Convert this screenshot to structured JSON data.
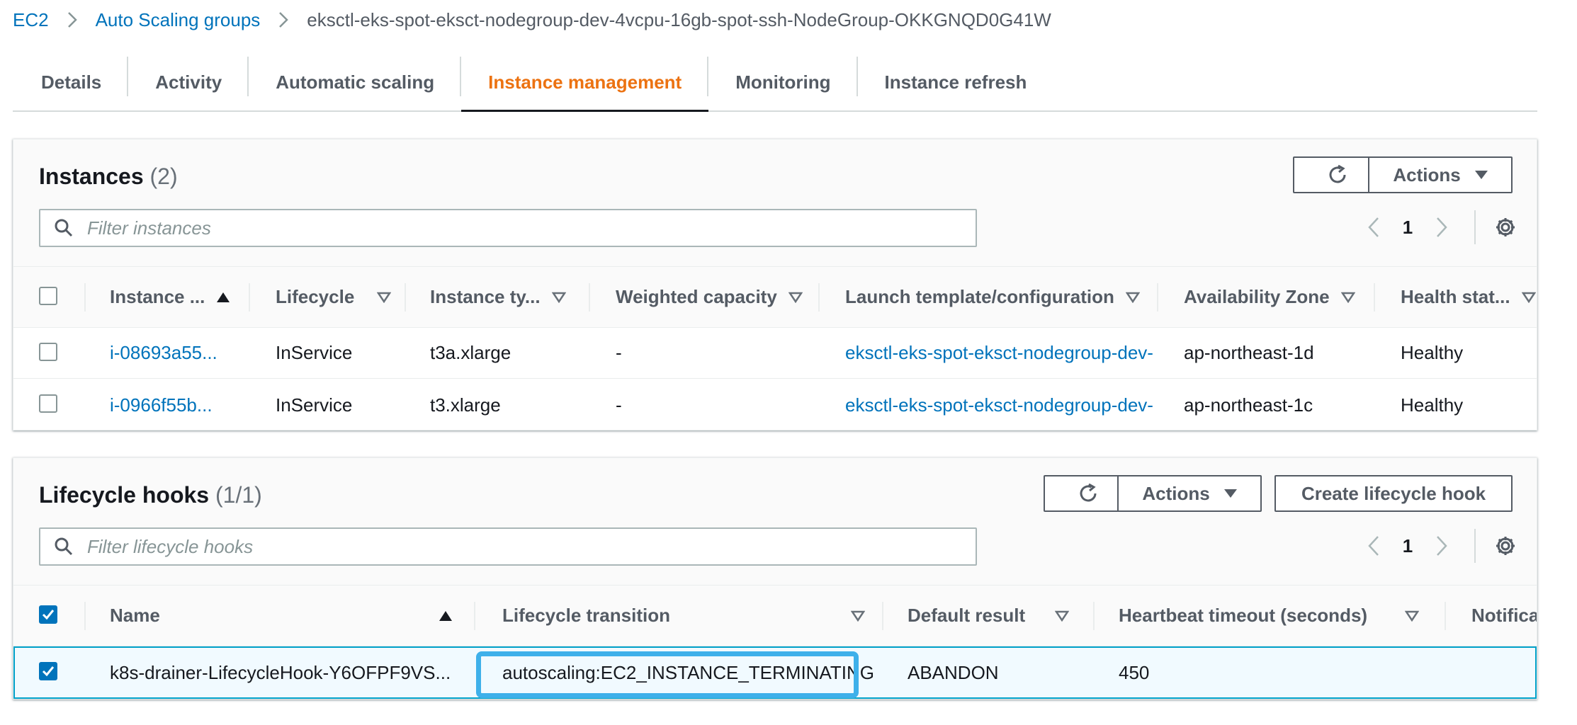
{
  "breadcrumb": {
    "items": [
      "EC2",
      "Auto Scaling groups"
    ],
    "current": "eksctl-eks-spot-eksct-nodegroup-dev-4vcpu-16gb-spot-ssh-NodeGroup-OKKGNQD0G41W"
  },
  "tabs": [
    {
      "label": "Details"
    },
    {
      "label": "Activity"
    },
    {
      "label": "Automatic scaling"
    },
    {
      "label": "Instance management",
      "active": true
    },
    {
      "label": "Monitoring"
    },
    {
      "label": "Instance refresh"
    }
  ],
  "instances": {
    "title": "Instances",
    "count": "(2)",
    "actions_label": "Actions",
    "filter_placeholder": "Filter instances",
    "page": "1",
    "columns": [
      "Instance ...",
      "Lifecycle",
      "Instance ty...",
      "Weighted capacity",
      "Launch template/configuration",
      "Availability Zone",
      "Health stat..."
    ],
    "rows": [
      {
        "id": "i-08693a55...",
        "lifecycle": "InService",
        "type": "t3a.xlarge",
        "weight": "-",
        "template": "eksctl-eks-spot-eksct-nodegroup-dev-",
        "az": "ap-northeast-1d",
        "health": "Healthy"
      },
      {
        "id": "i-0966f55b...",
        "lifecycle": "InService",
        "type": "t3.xlarge",
        "weight": "-",
        "template": "eksctl-eks-spot-eksct-nodegroup-dev-",
        "az": "ap-northeast-1c",
        "health": "Healthy"
      }
    ]
  },
  "hooks": {
    "title": "Lifecycle hooks",
    "count": "(1/1)",
    "actions_label": "Actions",
    "create_label": "Create lifecycle hook",
    "filter_placeholder": "Filter lifecycle hooks",
    "page": "1",
    "columns": [
      "Name",
      "Lifecycle transition",
      "Default result",
      "Heartbeat timeout (seconds)",
      "Notifica"
    ],
    "rows": [
      {
        "name": "k8s-drainer-LifecycleHook-Y6OFPF9VS...",
        "transition": "autoscaling:EC2_INSTANCE_TERMINATING",
        "result": "ABANDON",
        "timeout": "450",
        "notification": ""
      }
    ]
  },
  "icons": {
    "refresh": "refresh-icon",
    "settings": "gear-icon",
    "search": "search-icon",
    "prev": "chevron-left-icon",
    "next": "chevron-right-icon",
    "sort_asc": "sort-ascending-icon",
    "sort": "sort-descending-icon"
  },
  "colors": {
    "link": "#0073bb",
    "active_tab": "#ec7211",
    "highlight": "#3eb0ea",
    "selected_row": "#f1faff"
  }
}
